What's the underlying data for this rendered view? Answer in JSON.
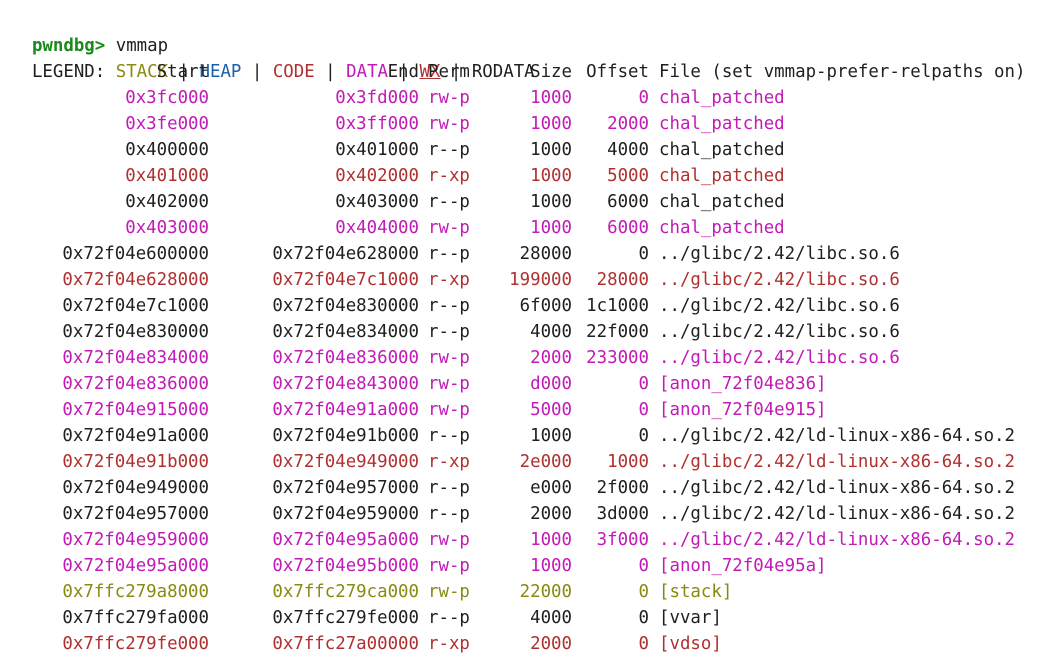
{
  "colors": {
    "prompt": "#1a8a1a",
    "plain": "#1f1f1f",
    "data": "#c21ab6",
    "code": "#b03030",
    "stack": "#8a8a10",
    "heap": "#1a5fa8",
    "background": "#ffffff"
  },
  "prompt": {
    "label": "pwndbg>",
    "command": " vmmap"
  },
  "legend": {
    "prefix": "LEGEND: ",
    "stack": "STACK",
    "heap": "HEAP",
    "code": "CODE",
    "data": "DATA",
    "wx": "WX",
    "rodata": "RODATA",
    "sep": " | "
  },
  "header": {
    "start": "Start",
    "end": "End",
    "perm": "Perm",
    "size": "Size",
    "offset": "Offset",
    "file": "File (set vmmap-prefer-relpaths on)"
  },
  "rows": [
    {
      "start": "0x3fc000",
      "end": "0x3fd000",
      "perm": "rw-p",
      "size": "1000",
      "offset": "0",
      "file": "chal_patched",
      "kind": "data"
    },
    {
      "start": "0x3fe000",
      "end": "0x3ff000",
      "perm": "rw-p",
      "size": "1000",
      "offset": "2000",
      "file": "chal_patched",
      "kind": "data"
    },
    {
      "start": "0x400000",
      "end": "0x401000",
      "perm": "r--p",
      "size": "1000",
      "offset": "4000",
      "file": "chal_patched",
      "kind": "plain"
    },
    {
      "start": "0x401000",
      "end": "0x402000",
      "perm": "r-xp",
      "size": "1000",
      "offset": "5000",
      "file": "chal_patched",
      "kind": "code"
    },
    {
      "start": "0x402000",
      "end": "0x403000",
      "perm": "r--p",
      "size": "1000",
      "offset": "6000",
      "file": "chal_patched",
      "kind": "plain"
    },
    {
      "start": "0x403000",
      "end": "0x404000",
      "perm": "rw-p",
      "size": "1000",
      "offset": "6000",
      "file": "chal_patched",
      "kind": "data"
    },
    {
      "start": "0x72f04e600000",
      "end": "0x72f04e628000",
      "perm": "r--p",
      "size": "28000",
      "offset": "0",
      "file": "../glibc/2.42/libc.so.6",
      "kind": "plain"
    },
    {
      "start": "0x72f04e628000",
      "end": "0x72f04e7c1000",
      "perm": "r-xp",
      "size": "199000",
      "offset": "28000",
      "file": "../glibc/2.42/libc.so.6",
      "kind": "code"
    },
    {
      "start": "0x72f04e7c1000",
      "end": "0x72f04e830000",
      "perm": "r--p",
      "size": "6f000",
      "offset": "1c1000",
      "file": "../glibc/2.42/libc.so.6",
      "kind": "plain"
    },
    {
      "start": "0x72f04e830000",
      "end": "0x72f04e834000",
      "perm": "r--p",
      "size": "4000",
      "offset": "22f000",
      "file": "../glibc/2.42/libc.so.6",
      "kind": "plain"
    },
    {
      "start": "0x72f04e834000",
      "end": "0x72f04e836000",
      "perm": "rw-p",
      "size": "2000",
      "offset": "233000",
      "file": "../glibc/2.42/libc.so.6",
      "kind": "data"
    },
    {
      "start": "0x72f04e836000",
      "end": "0x72f04e843000",
      "perm": "rw-p",
      "size": "d000",
      "offset": "0",
      "file": "[anon_72f04e836]",
      "kind": "data"
    },
    {
      "start": "0x72f04e915000",
      "end": "0x72f04e91a000",
      "perm": "rw-p",
      "size": "5000",
      "offset": "0",
      "file": "[anon_72f04e915]",
      "kind": "data"
    },
    {
      "start": "0x72f04e91a000",
      "end": "0x72f04e91b000",
      "perm": "r--p",
      "size": "1000",
      "offset": "0",
      "file": "../glibc/2.42/ld-linux-x86-64.so.2",
      "kind": "plain"
    },
    {
      "start": "0x72f04e91b000",
      "end": "0x72f04e949000",
      "perm": "r-xp",
      "size": "2e000",
      "offset": "1000",
      "file": "../glibc/2.42/ld-linux-x86-64.so.2",
      "kind": "code"
    },
    {
      "start": "0x72f04e949000",
      "end": "0x72f04e957000",
      "perm": "r--p",
      "size": "e000",
      "offset": "2f000",
      "file": "../glibc/2.42/ld-linux-x86-64.so.2",
      "kind": "plain"
    },
    {
      "start": "0x72f04e957000",
      "end": "0x72f04e959000",
      "perm": "r--p",
      "size": "2000",
      "offset": "3d000",
      "file": "../glibc/2.42/ld-linux-x86-64.so.2",
      "kind": "plain"
    },
    {
      "start": "0x72f04e959000",
      "end": "0x72f04e95a000",
      "perm": "rw-p",
      "size": "1000",
      "offset": "3f000",
      "file": "../glibc/2.42/ld-linux-x86-64.so.2",
      "kind": "data"
    },
    {
      "start": "0x72f04e95a000",
      "end": "0x72f04e95b000",
      "perm": "rw-p",
      "size": "1000",
      "offset": "0",
      "file": "[anon_72f04e95a]",
      "kind": "data"
    },
    {
      "start": "0x7ffc279a8000",
      "end": "0x7ffc279ca000",
      "perm": "rw-p",
      "size": "22000",
      "offset": "0",
      "file": "[stack]",
      "kind": "stack"
    },
    {
      "start": "0x7ffc279fa000",
      "end": "0x7ffc279fe000",
      "perm": "r--p",
      "size": "4000",
      "offset": "0",
      "file": "[vvar]",
      "kind": "plain"
    },
    {
      "start": "0x7ffc279fe000",
      "end": "0x7ffc27a00000",
      "perm": "r-xp",
      "size": "2000",
      "offset": "0",
      "file": "[vdso]",
      "kind": "code"
    }
  ]
}
